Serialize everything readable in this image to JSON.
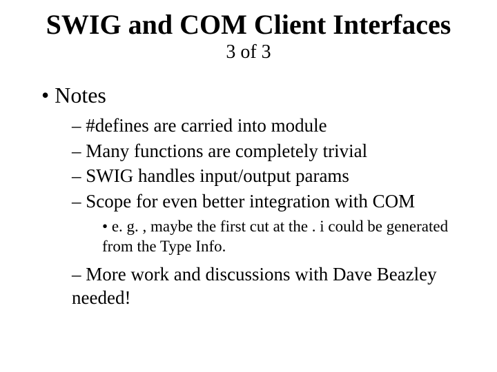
{
  "title": "SWIG and COM Client Interfaces",
  "subtitle": "3 of 3",
  "bullets": {
    "l1_0": "Notes",
    "l2_0": "#defines are carried into module",
    "l2_1": "Many functions are completely trivial",
    "l2_2": "SWIG handles input/output params",
    "l2_3": "Scope for even better integration with COM",
    "l3_0": "e. g. , maybe the first cut at the . i could be generated from the Type Info.",
    "l2_4": "More work and discussions with Dave Beazley needed!"
  }
}
